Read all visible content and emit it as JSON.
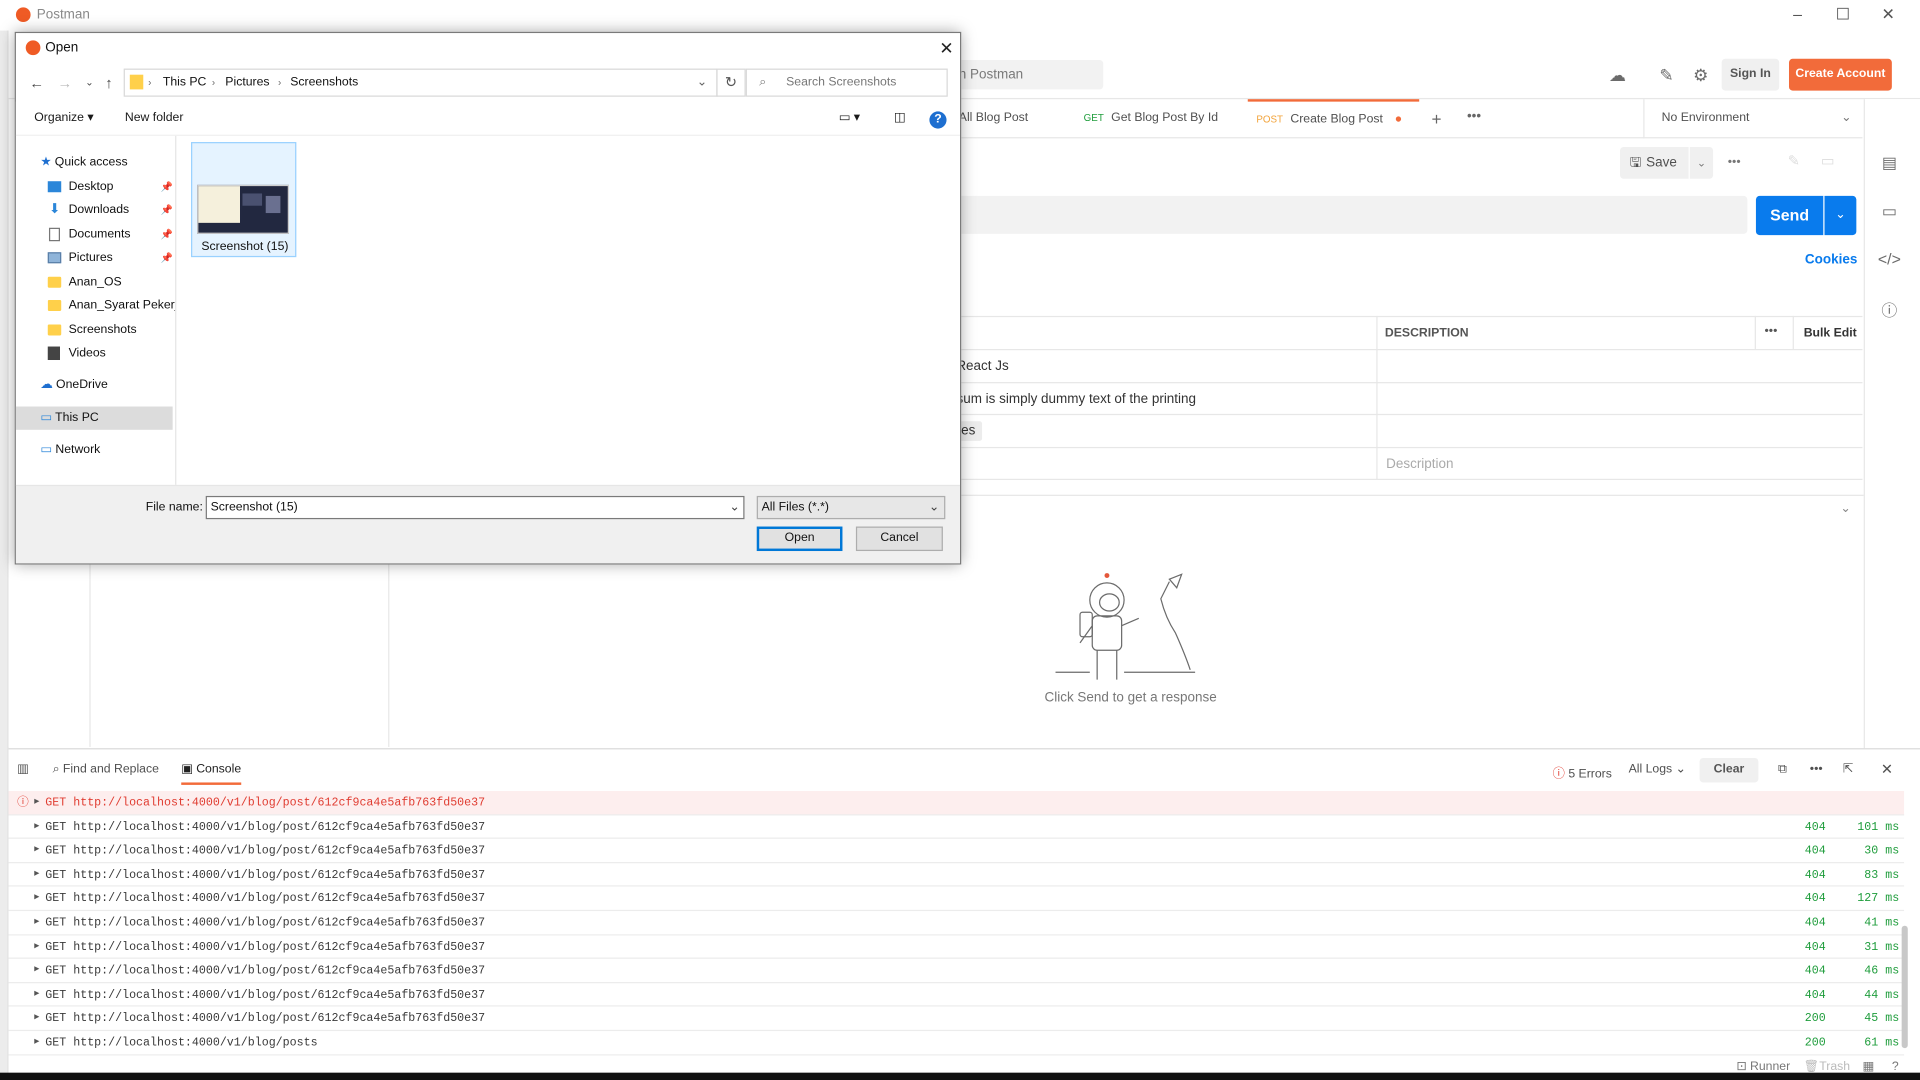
{
  "postman": {
    "window_title": "Postman",
    "search_placeholder": "h Postman",
    "sign_in": "Sign In",
    "create_account": "Create Account",
    "tabs": [
      {
        "method": "",
        "label": "All Blog Post"
      },
      {
        "method": "GET",
        "label": "Get Blog Post By Id"
      },
      {
        "method": "POST",
        "label": "Create Blog Post"
      }
    ],
    "environment": "No Environment",
    "save_label": "Save",
    "send_label": "Send",
    "cookies_label": "Cookies",
    "table": {
      "description_header": "DESCRIPTION",
      "bulk_edit": "Bulk Edit",
      "rows": [
        {
          "value": "React Js",
          "description": ""
        },
        {
          "value": "psum is simply dummy text of the printing",
          "description": ""
        },
        {
          "value": "iles",
          "description": ""
        },
        {
          "value": "",
          "description": "Description"
        }
      ]
    },
    "response_hint": "Click Send to get a response"
  },
  "console": {
    "find_replace": "Find and Replace",
    "console_tab": "Console",
    "errors": "5 Errors",
    "log_filter": "All Logs",
    "clear": "Clear",
    "logs": [
      {
        "text": "GET http://localhost:4000/v1/blog/post/612cf9ca4e5afb763fd50e37",
        "status": "",
        "time": "",
        "error": true
      },
      {
        "text": "GET http://localhost:4000/v1/blog/post/612cf9ca4e5afb763fd50e37",
        "status": "404",
        "time": "101 ms",
        "error": false
      },
      {
        "text": "GET http://localhost:4000/v1/blog/post/612cf9ca4e5afb763fd50e37",
        "status": "404",
        "time": "30 ms",
        "error": false
      },
      {
        "text": "GET http://localhost:4000/v1/blog/post/612cf9ca4e5afb763fd50e37",
        "status": "404",
        "time": "83 ms",
        "error": false
      },
      {
        "text": "GET http://localhost:4000/v1/blog/post/612cf9ca4e5afb763fd50e37",
        "status": "404",
        "time": "127 ms",
        "error": false
      },
      {
        "text": "GET http://localhost:4000/v1/blog/post/612cf9ca4e5afb763fd50e37",
        "status": "404",
        "time": "41 ms",
        "error": false
      },
      {
        "text": "GET http://localhost:4000/v1/blog/post/612cf9ca4e5afb763fd50e37",
        "status": "404",
        "time": "31 ms",
        "error": false
      },
      {
        "text": "GET http://localhost:4000/v1/blog/post/612cf9ca4e5afb763fd50e37",
        "status": "404",
        "time": "46 ms",
        "error": false
      },
      {
        "text": "GET http://localhost:4000/v1/blog/post/612cf9ca4e5afb763fd50e37",
        "status": "404",
        "time": "44 ms",
        "error": false
      },
      {
        "text": "GET http://localhost:4000/v1/blog/post/612cf9ca4e5afb763fd50e37",
        "status": "200",
        "time": "45 ms",
        "error": false
      },
      {
        "text": "GET http://localhost:4000/v1/blog/posts",
        "status": "200",
        "time": "61 ms",
        "error": false
      }
    ],
    "footer": {
      "runner": "Runner",
      "trash": "Trash"
    }
  },
  "dialog": {
    "title": "Open",
    "breadcrumb": [
      "This PC",
      "Pictures",
      "Screenshots"
    ],
    "search_placeholder": "Search Screenshots",
    "organize": "Organize",
    "new_folder": "New folder",
    "nav": {
      "quick_access": "Quick access",
      "items": [
        "Desktop",
        "Downloads",
        "Documents",
        "Pictures",
        "Anan_OS",
        "Anan_Syarat Pekerja",
        "Screenshots",
        "Videos"
      ],
      "onedrive": "OneDrive",
      "this_pc": "This PC",
      "network": "Network"
    },
    "file": {
      "name": "Screenshot (15)"
    },
    "file_name_label": "File name:",
    "file_name_value": "Screenshot (15)",
    "file_type": "All Files (*.*)",
    "open": "Open",
    "cancel": "Cancel"
  },
  "colors": {
    "accent": "#f26b3a",
    "send": "#097bed",
    "success": "#1f9d3c",
    "error": "#e03c31"
  }
}
